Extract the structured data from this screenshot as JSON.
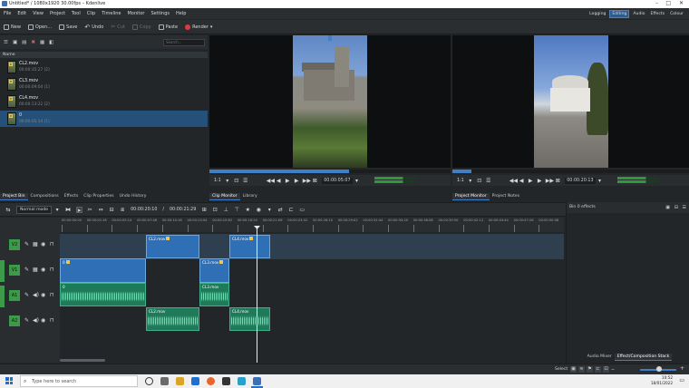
{
  "window": {
    "title": "Untitled* / 1080x1920 30.00fps – Kdenlive"
  },
  "menu": [
    "File",
    "Edit",
    "View",
    "Project",
    "Tool",
    "Clip",
    "Timeline",
    "Monitor",
    "Settings",
    "Help"
  ],
  "layouts": [
    {
      "label": "Logging",
      "active": false
    },
    {
      "label": "Editing",
      "active": true
    },
    {
      "label": "Audio",
      "active": false
    },
    {
      "label": "Effects",
      "active": false
    },
    {
      "label": "Colour",
      "active": false
    }
  ],
  "toolbar": {
    "new": "New",
    "open": "Open...",
    "save": "Save",
    "undo": "Undo",
    "cut": "Cut",
    "copy": "Copy",
    "paste": "Paste",
    "render": "Render"
  },
  "bin": {
    "search_placeholder": "Search...",
    "header": "Name",
    "clips": [
      {
        "name": "CL2.mov",
        "duration": "00:00:35:27 [2]",
        "selected": false
      },
      {
        "name": "CL3.mov",
        "duration": "00:00:09:04 [1]",
        "selected": false
      },
      {
        "name": "CL4.mov",
        "duration": "00:00:13:22 [2]",
        "selected": false
      },
      {
        "name": "0",
        "duration": "00:00:05:14 [1]",
        "selected": true
      }
    ]
  },
  "clip_monitor": {
    "zoom": "1:1",
    "timecode": "00:00:05:07",
    "progress_fraction": 0.58
  },
  "project_monitor": {
    "zoom": "1:1",
    "timecode": "00:00:20:13",
    "progress_fraction": 0.08
  },
  "tabs_left": [
    {
      "label": "Project Bin",
      "active": true
    },
    {
      "label": "Compositions",
      "active": false
    },
    {
      "label": "Effects",
      "active": false
    },
    {
      "label": "Clip Properties",
      "active": false
    },
    {
      "label": "Undo History",
      "active": false
    }
  ],
  "tabs_clip_monitor": [
    {
      "label": "Clip Monitor",
      "active": true
    },
    {
      "label": "Library",
      "active": false
    }
  ],
  "tabs_project_monitor": [
    {
      "label": "Project Monitor",
      "active": true
    },
    {
      "label": "Project Notes",
      "active": false
    }
  ],
  "timeline_toolbar": {
    "mode": "Normal mode",
    "position": "00:00:20:10",
    "separator": "/",
    "duration": "00:00:21:29"
  },
  "timeline": {
    "ruler_labels": [
      "00:00:00:00",
      "00:00:02:16",
      "00:00:05:14",
      "00:00:07:46",
      "00:00:10:18",
      "00:00:13:04",
      "00:00:15:62",
      "00:00:18:24",
      "00:00:21:06",
      "00:00:23:52",
      "00:00:26:10",
      "00:00:29:02",
      "00:00:31:44",
      "00:00:34:20",
      "00:00:36:08",
      "00:00:39:50",
      "00:00:42:12",
      "00:00:44:44",
      "00:00:47:26",
      "00:00:50:08"
    ],
    "tracks": [
      {
        "name": "V2",
        "kind": "video"
      },
      {
        "name": "V1",
        "kind": "video"
      },
      {
        "name": "A1",
        "kind": "audio"
      },
      {
        "name": "A2",
        "kind": "audio"
      }
    ],
    "clips": {
      "v2": [
        {
          "label": "CL2.mov"
        },
        {
          "label": "CL4.mov"
        }
      ],
      "v1": [
        {
          "label": "0"
        },
        {
          "label": "CL3.mov"
        }
      ],
      "a1": [
        {
          "label": "0"
        },
        {
          "label": "CL3.mov"
        }
      ],
      "a2": [
        {
          "label": "CL2.mov"
        },
        {
          "label": "CL4.mov"
        }
      ]
    }
  },
  "effects_panel": {
    "title": "Bin 0 effects",
    "tabs": [
      {
        "label": "Audio Mixer",
        "active": false
      },
      {
        "label": "Effect/Composition Stack",
        "active": true
      }
    ]
  },
  "statusbar": {
    "select": "Select"
  },
  "taskbar": {
    "search_placeholder": "Type here to search",
    "time": "10:52",
    "date": "18/01/2022"
  },
  "colors": {
    "accent": "#3f7fc8",
    "video_clip": "#2e6fb5",
    "audio_clip": "#1f7a5a",
    "track_label": "#3c9a4a"
  }
}
